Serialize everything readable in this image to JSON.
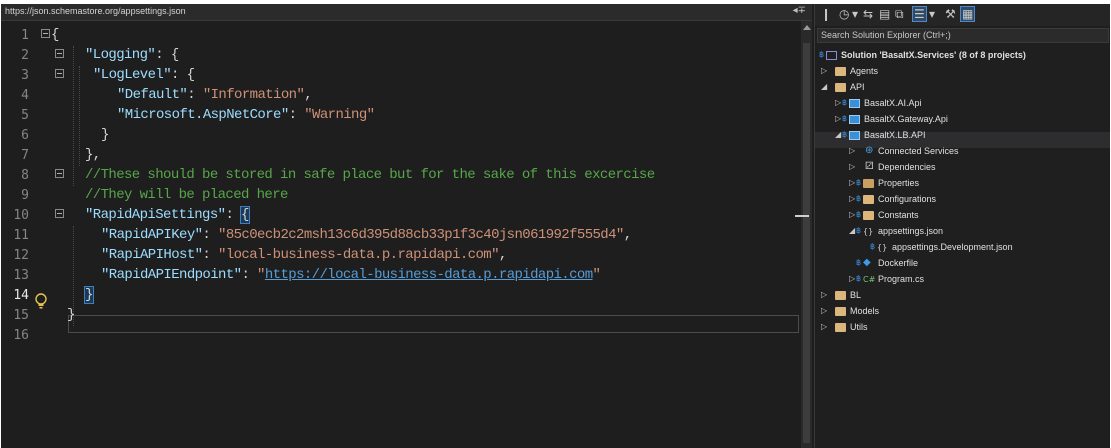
{
  "editor": {
    "schema_url": "https://json.schemastore.org/appsettings.json",
    "split_glyph": "◂∓",
    "lines": [
      {
        "n": "1"
      },
      {
        "n": "2"
      },
      {
        "n": "3"
      },
      {
        "n": "4"
      },
      {
        "n": "5"
      },
      {
        "n": "6"
      },
      {
        "n": "7"
      },
      {
        "n": "8"
      },
      {
        "n": "9"
      },
      {
        "n": "10"
      },
      {
        "n": "11"
      },
      {
        "n": "12"
      },
      {
        "n": "13"
      },
      {
        "n": "14"
      },
      {
        "n": "15"
      },
      {
        "n": "16"
      }
    ],
    "code": {
      "l1_brace": "{",
      "l2_key": "\"Logging\"",
      "l2_rest": ": {",
      "l3_key": "\"LogLevel\"",
      "l3_rest": ": {",
      "l4_key": "\"Default\"",
      "l4_colon": ": ",
      "l4_val": "\"Information\"",
      "l4_comma": ",",
      "l5_key": "\"Microsoft.AspNetCore\"",
      "l5_colon": ": ",
      "l5_val": "\"Warning\"",
      "l6": "}",
      "l7": "},",
      "l8_comment": "//These should be stored in safe place but for the sake of this excercise",
      "l9_comment": "//They will be placed here",
      "l10_key": "\"RapidApiSettings\"",
      "l10_colon": ": ",
      "l10_brace": "{",
      "l11_key": "\"RapidAPIKey\"",
      "l11_colon": ": ",
      "l11_val": "\"85c0ecb2c2msh13c6d395d88cb33p1f3c40jsn061992f555d4\"",
      "l11_comma": ",",
      "l12_key": "\"RapiAPIHost\"",
      "l12_colon": ": ",
      "l12_val": "\"local-business-data.p.rapidapi.com\"",
      "l12_comma": ",",
      "l13_key": "\"RapidAPIEndpoint\"",
      "l13_colon": ": ",
      "l13_q1": "\"",
      "l13_url": "https://local-business-data.p.rapidapi.com",
      "l13_q2": "\"",
      "l14": "}",
      "l15": "}"
    }
  },
  "explorer": {
    "toolbar": [
      "❙",
      "◷",
      "▾",
      "⇆",
      "▤",
      "⧉",
      "☰",
      "▾",
      "⚒",
      "▦"
    ],
    "search_placeholder": "Search Solution Explorer (Ctrl+;)",
    "solution_label": "Solution 'BasaltX.Services' (8 of 8 projects)",
    "items": {
      "agents": "Agents",
      "api": "API",
      "ai_api": "BasaltX.AI.Api",
      "gateway_api": "BasaltX.Gateway.Api",
      "lb_api": "BasaltX.LB.API",
      "connected": "Connected Services",
      "dependencies": "Dependencies",
      "properties": "Properties",
      "configurations": "Configurations",
      "constants": "Constants",
      "appsettings": "appsettings.json",
      "appsettings_dev": "appsettings.Development.json",
      "dockerfile": "Dockerfile",
      "program": "Program.cs",
      "bl": "BL",
      "models": "Models",
      "utils": "Utils"
    },
    "glyphs": {
      "expanded": "◢",
      "collapsed": "▷",
      "lock": "฿",
      "connected": "⊛",
      "deps": "⚂",
      "cs": "C#",
      "docker": "◆",
      "json": "{}"
    }
  },
  "colors": {
    "key": "#9cdcfe",
    "string": "#ce9178",
    "comment": "#57a64a",
    "link": "#569cd6"
  }
}
